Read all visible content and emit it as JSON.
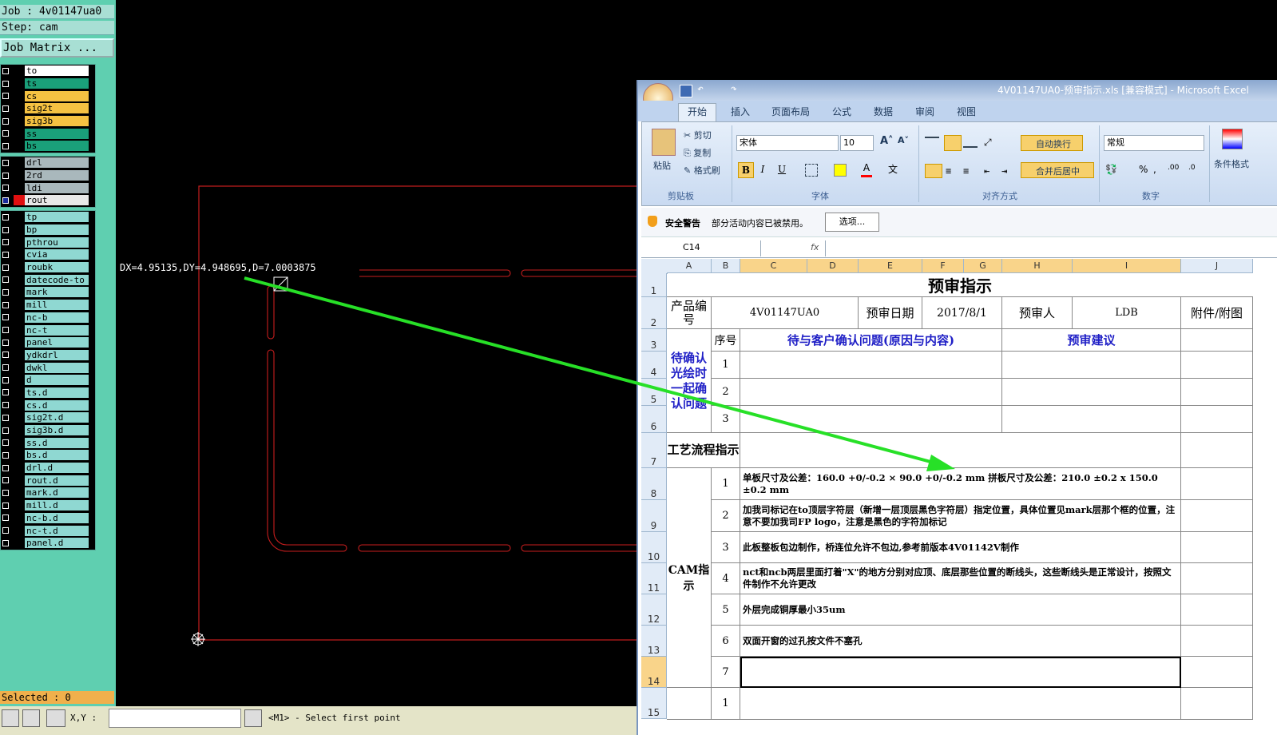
{
  "genesis": {
    "job": "Job : 4v01147ua0",
    "step": "Step: cam",
    "job_matrix": "Job Matrix ...",
    "selected": "Selected : 0",
    "measurement": "DX=4.95135,DY=4.948695,D=7.0003875",
    "status_prompt": "<M1> - Select first point",
    "coord_label": "X,Y :",
    "layer_groups": [
      [
        {
          "name": "to",
          "color": "#ffffff"
        },
        {
          "name": "ts",
          "color": "#1aa07a"
        },
        {
          "name": "cs",
          "color": "#f5c242"
        },
        {
          "name": "sig2t",
          "color": "#f5c242"
        },
        {
          "name": "sig3b",
          "color": "#f5c242"
        },
        {
          "name": "ss",
          "color": "#1aa07a"
        },
        {
          "name": "bs",
          "color": "#1aa07a"
        }
      ],
      [
        {
          "name": "drl",
          "color": "#a9b8bc"
        },
        {
          "name": "2rd",
          "color": "#a9b8bc"
        },
        {
          "name": "ldi",
          "color": "#a9b8bc"
        },
        {
          "name": "rout",
          "color": "#e8e8e8",
          "active": true
        }
      ],
      [
        {
          "name": "tp",
          "color": "#8fd8d2"
        },
        {
          "name": "bp",
          "color": "#8fd8d2"
        },
        {
          "name": "pthrou",
          "color": "#8fd8d2"
        },
        {
          "name": "cvia",
          "color": "#8fd8d2"
        },
        {
          "name": "roubk",
          "color": "#8fd8d2"
        },
        {
          "name": "datecode-to",
          "color": "#8fd8d2"
        },
        {
          "name": "mark",
          "color": "#8fd8d2"
        },
        {
          "name": "mill",
          "color": "#8fd8d2"
        },
        {
          "name": "nc-b",
          "color": "#8fd8d2"
        },
        {
          "name": "nc-t",
          "color": "#8fd8d2"
        },
        {
          "name": "panel",
          "color": "#8fd8d2"
        },
        {
          "name": "ydkdrl",
          "color": "#8fd8d2"
        },
        {
          "name": "dwkl",
          "color": "#8fd8d2"
        },
        {
          "name": "d",
          "color": "#8fd8d2"
        },
        {
          "name": "ts.d",
          "color": "#8fd8d2"
        },
        {
          "name": "cs.d",
          "color": "#8fd8d2"
        },
        {
          "name": "sig2t.d",
          "color": "#8fd8d2"
        },
        {
          "name": "sig3b.d",
          "color": "#8fd8d2"
        },
        {
          "name": "ss.d",
          "color": "#8fd8d2"
        },
        {
          "name": "bs.d",
          "color": "#8fd8d2"
        },
        {
          "name": "drl.d",
          "color": "#8fd8d2"
        },
        {
          "name": "rout.d",
          "color": "#8fd8d2"
        },
        {
          "name": "mark.d",
          "color": "#8fd8d2"
        },
        {
          "name": "mill.d",
          "color": "#8fd8d2"
        },
        {
          "name": "nc-b.d",
          "color": "#8fd8d2"
        },
        {
          "name": "nc-t.d",
          "color": "#8fd8d2"
        },
        {
          "name": "panel.d",
          "color": "#8fd8d2"
        }
      ]
    ]
  },
  "excel": {
    "title": "4V01147UA0-预审指示.xls [兼容模式] - Microsoft Excel",
    "tabs": [
      "开始",
      "插入",
      "页面布局",
      "公式",
      "数据",
      "审阅",
      "视图"
    ],
    "clipboard": {
      "paste": "粘贴",
      "cut": "剪切",
      "copy": "复制",
      "format_painter": "格式刷",
      "label": "剪贴板"
    },
    "font": {
      "name": "宋体",
      "size": "10",
      "label": "字体"
    },
    "alignment": {
      "wrap": "自动换行",
      "merge": "合并后居中",
      "label": "对齐方式"
    },
    "number": {
      "format": "常规",
      "label": "数字"
    },
    "styles": {
      "conditional": "条件格式"
    },
    "security": {
      "title": "安全警告",
      "message": "部分活动内容已被禁用。",
      "options": "选项..."
    },
    "name_box": "C14",
    "fx": "fx",
    "columns": [
      "A",
      "B",
      "C",
      "D",
      "E",
      "F",
      "G",
      "H",
      "I",
      "J"
    ],
    "rows": [
      "1",
      "2",
      "3",
      "4",
      "5",
      "6",
      "7",
      "8",
      "9",
      "10",
      "11",
      "12",
      "13",
      "14",
      "15"
    ],
    "sheet": {
      "title": "预审指示",
      "product_no_label": "产品编号",
      "product_no": "4V01147UA0",
      "date_label": "预审日期",
      "date": "2017/8/1",
      "reviewer_label": "预审人",
      "reviewer": "LDB",
      "attachment_label": "附件/附图",
      "seq_label": "序号",
      "questions_label": "待与客户确认问题(原因与内容)",
      "advice_label": "预审建议",
      "confirm_label": "待确认光绘时一起确认问题",
      "process_label": "工艺流程指示",
      "cam_label": "CAM指示",
      "nums": [
        "1",
        "2",
        "3"
      ],
      "instructions": [
        {
          "n": "1",
          "text": "单板尺寸及公差：160.0 +0/-0.2 × 90.0 +0/-0.2 mm  拼板尺寸及公差：210.0 ±0.2 x 150.0 ±0.2 mm"
        },
        {
          "n": "2",
          "text": "加我司标记在to顶层字符层（新增一层顶层黑色字符层）指定位置，具体位置见mark层那个框的位置，注意不要加我司FP logo，注意是黑色的字符加标记"
        },
        {
          "n": "3",
          "text": "此板整板包边制作，桥连位允许不包边,参考前版本4V01142V制作"
        },
        {
          "n": "4",
          "text": "nct和ncb两层里面打着\"X\"的地方分别对应顶、底层那些位置的断线头，这些断线头是正常设计，按照文件制作不允许更改"
        },
        {
          "n": "5",
          "text": "外层完成铜厚最小35um"
        },
        {
          "n": "6",
          "text": "双面开窗的过孔按文件不塞孔"
        },
        {
          "n": "7",
          "text": ""
        }
      ],
      "row15_n": "1"
    }
  }
}
